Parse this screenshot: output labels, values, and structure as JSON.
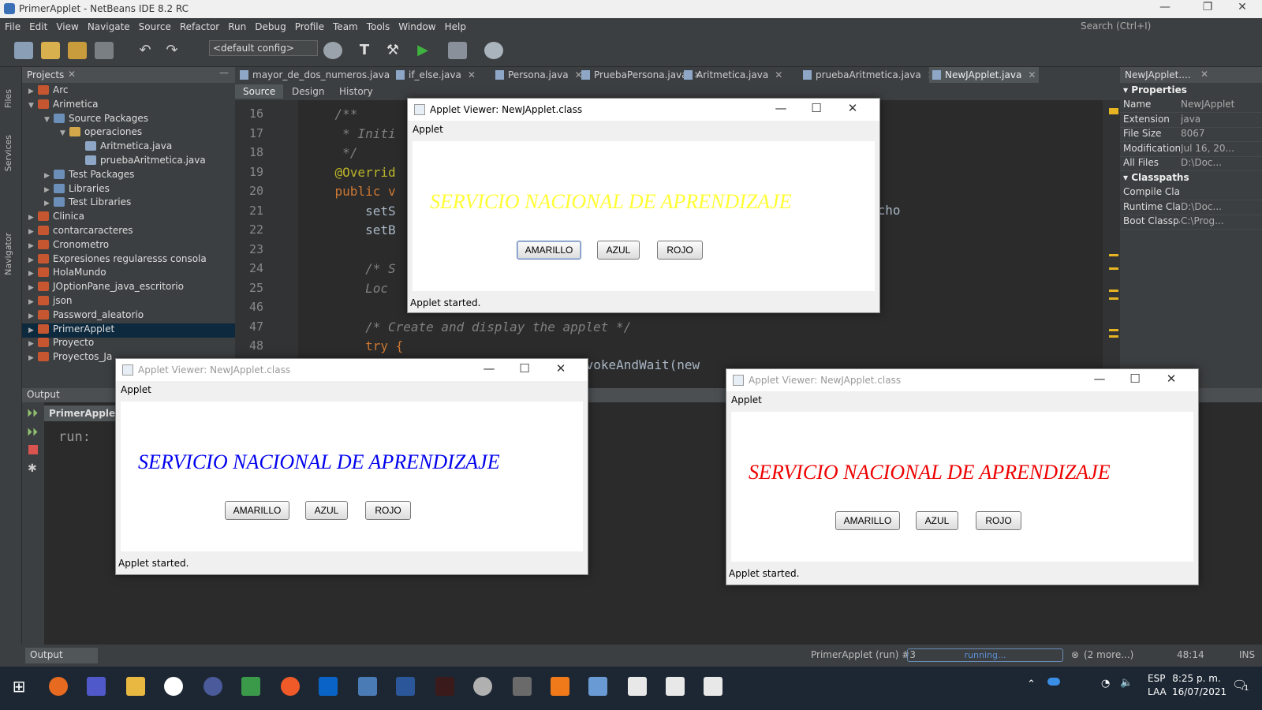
{
  "window": {
    "title": "PrimerApplet - NetBeans IDE 8.2 RC"
  },
  "menu": [
    "File",
    "Edit",
    "View",
    "Navigate",
    "Source",
    "Refactor",
    "Run",
    "Debug",
    "Profile",
    "Team",
    "Tools",
    "Window",
    "Help"
  ],
  "search": {
    "placeholder": "Search (Ctrl+I)"
  },
  "toolbar": {
    "config": "<default config>"
  },
  "left_strip": [
    "Files",
    "Services",
    "Navigator"
  ],
  "projects": {
    "title": "Projects",
    "rows": [
      {
        "label": "Arc",
        "level": 0,
        "icon": "project-icon",
        "arrow": "▶"
      },
      {
        "label": "Arimetica",
        "level": 0,
        "icon": "project-icon",
        "arrow": "▼"
      },
      {
        "label": "Source Packages",
        "level": 1,
        "icon": "source-packages-icon",
        "arrow": "▼"
      },
      {
        "label": "operaciones",
        "level": 2,
        "icon": "package-icon",
        "arrow": "▼"
      },
      {
        "label": "Aritmetica.java",
        "level": 3,
        "icon": "java-file-icon",
        "arrow": ""
      },
      {
        "label": "pruebaAritmetica.java",
        "level": 3,
        "icon": "java-file-icon",
        "arrow": ""
      },
      {
        "label": "Test Packages",
        "level": 1,
        "icon": "folder-icon",
        "arrow": "▶"
      },
      {
        "label": "Libraries",
        "level": 1,
        "icon": "folder-icon",
        "arrow": "▶"
      },
      {
        "label": "Test Libraries",
        "level": 1,
        "icon": "folder-icon",
        "arrow": "▶"
      },
      {
        "label": "Clinica",
        "level": 0,
        "icon": "project-icon",
        "arrow": "▶"
      },
      {
        "label": "contarcaracteres",
        "level": 0,
        "icon": "project-icon",
        "arrow": "▶"
      },
      {
        "label": "Cronometro",
        "level": 0,
        "icon": "project-icon",
        "arrow": "▶"
      },
      {
        "label": "Expresiones regularesss consola",
        "level": 0,
        "icon": "project-icon",
        "arrow": "▶"
      },
      {
        "label": "HolaMundo",
        "level": 0,
        "icon": "project-icon",
        "arrow": "▶"
      },
      {
        "label": "JOptionPane_java_escritorio",
        "level": 0,
        "icon": "project-icon",
        "arrow": "▶"
      },
      {
        "label": "json",
        "level": 0,
        "icon": "project-icon",
        "arrow": "▶"
      },
      {
        "label": "Password_aleatorio",
        "level": 0,
        "icon": "project-icon",
        "arrow": "▶"
      },
      {
        "label": "PrimerApplet",
        "level": 0,
        "icon": "project-icon",
        "arrow": "▶",
        "selected": true
      },
      {
        "label": "Proyecto",
        "level": 0,
        "icon": "project-icon",
        "arrow": "▶"
      },
      {
        "label": "Proyectos_Ja",
        "level": 0,
        "icon": "project-icon",
        "arrow": "▶"
      }
    ]
  },
  "editor_tabs": [
    "mayor_de_dos_numeros.java",
    "if_else.java",
    "Persona.java",
    "PruebaPersona.java",
    "Aritmetica.java",
    "pruebaAritmetica.java",
    "NewJApplet.java"
  ],
  "editor_toolbar": {
    "source": "Source",
    "design": "Design",
    "history": "History"
  },
  "code_lines": [
    {
      "n": "16",
      "text": "    /**",
      "cls": "cm"
    },
    {
      "n": "17",
      "text": "     * Initi",
      "cls": "cm"
    },
    {
      "n": "18",
      "text": "     */",
      "cls": "cm"
    },
    {
      "n": "19",
      "text": "    @Overrid",
      "cls": "an"
    },
    {
      "n": "20",
      "text": "    public v",
      "cls": "kw"
    },
    {
      "n": "21",
      "text": "        setS",
      "cls": ""
    },
    {
      "n": "22",
      "text": "        setB",
      "cls": ""
    },
    {
      "n": "23",
      "text": "",
      "cls": ""
    },
    {
      "n": "24",
      "text": "        /* S",
      "cls": "cm"
    },
    {
      "n": "25",
      "text": "        Loc",
      "cls": "cm"
    },
    {
      "n": "46",
      "text": "",
      "cls": ""
    },
    {
      "n": "47",
      "text": "        /* Create and display the applet */",
      "cls": "cm"
    },
    {
      "n": "48",
      "text": "        try {",
      "cls": "kw"
    }
  ],
  "code_fragments": {
    "ancho": "ncho",
    "invoke": "nvokeAndWait(new"
  },
  "properties": {
    "title": "NewJApplet....",
    "section1": "Properties",
    "section2": "Classpaths",
    "rows1": [
      {
        "k": "Name",
        "v": "NewJApplet"
      },
      {
        "k": "Extension",
        "v": "java"
      },
      {
        "k": "File Size",
        "v": "8067"
      },
      {
        "k": "Modification T",
        "v": "Jul 16, 20..."
      },
      {
        "k": "All Files",
        "v": "D:\\Doc..."
      }
    ],
    "rows2": [
      {
        "k": "Compile Clas",
        "v": ""
      },
      {
        "k": "Runtime Clas",
        "v": "D:\\Doc..."
      },
      {
        "k": "Boot Classpa",
        "v": "C:\\Prog..."
      }
    ]
  },
  "output": {
    "title": "Output",
    "tab": "PrimerApplet (",
    "text": "run:"
  },
  "statusbar": {
    "output_btn": "Output",
    "task": "PrimerApplet (run) #3",
    "progress": "running...",
    "more": "(2 more...)",
    "position": "48:14",
    "mode": "INS"
  },
  "applets": [
    {
      "id": "yellow",
      "title": "Applet Viewer: NewJApplet.class",
      "menu": "Applet",
      "heading": "SERVICIO NACIONAL DE APRENDIZAJE",
      "color": "#ffff33",
      "status": "Applet started.",
      "buttons": [
        "AMARILLO",
        "AZUL",
        "ROJO"
      ],
      "active": true
    },
    {
      "id": "blue",
      "title": "Applet Viewer: NewJApplet.class",
      "menu": "Applet",
      "heading": "SERVICIO NACIONAL DE APRENDIZAJE",
      "color": "#0000ee",
      "status": "Applet started.",
      "buttons": [
        "AMARILLO",
        "AZUL",
        "ROJO"
      ],
      "active": false
    },
    {
      "id": "red",
      "title": "Applet Viewer: NewJApplet.class",
      "menu": "Applet",
      "heading": "SERVICIO NACIONAL DE APRENDIZAJE",
      "color": "#ee0000",
      "status": "Applet started.",
      "buttons": [
        "AMARILLO",
        "AZUL",
        "ROJO"
      ],
      "active": false
    }
  ],
  "taskbar": {
    "lang1": "ESP",
    "lang2": "LAA",
    "time": "8:25 p. m.",
    "date": "16/07/2021",
    "notif": "1"
  }
}
